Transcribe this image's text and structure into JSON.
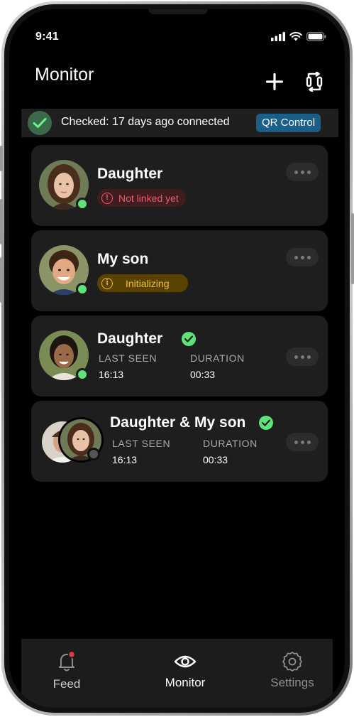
{
  "status_bar": {
    "time": "9:41"
  },
  "header": {
    "title": "Monitor",
    "add_icon": "plus-icon",
    "switch_icon": "swap-icon"
  },
  "banner": {
    "text": "Checked: 17 days ago connected",
    "button": "QR Control"
  },
  "devices": [
    {
      "name": "Daughter",
      "status": "Not linked yet",
      "status_type": "error",
      "online": true
    },
    {
      "name": "My son",
      "status": "Initializing",
      "status_type": "warning",
      "online": true
    },
    {
      "name": "Daughter",
      "verified": true,
      "online": true,
      "last_seen_label": "LAST SEEN",
      "last_seen": "16:13",
      "duration_label": "DURATION",
      "duration": "00:33"
    },
    {
      "name": "Daughter & My son",
      "verified": true,
      "online": false,
      "last_seen_label": "LAST SEEN",
      "last_seen": "16:13",
      "duration_label": "DURATION",
      "duration": "00:33"
    }
  ],
  "tabs": [
    {
      "label": "Feed",
      "icon": "bell-icon",
      "active": false,
      "has_notification": true
    },
    {
      "label": "Monitor",
      "icon": "eye-icon",
      "active": true
    },
    {
      "label": "Settings",
      "icon": "gear-icon",
      "active": false
    }
  ],
  "colors": {
    "accent_green": "#5ee27a",
    "error": "#ef5d6a",
    "warning": "#f0c020",
    "qr_button": "#1a5f8a"
  }
}
